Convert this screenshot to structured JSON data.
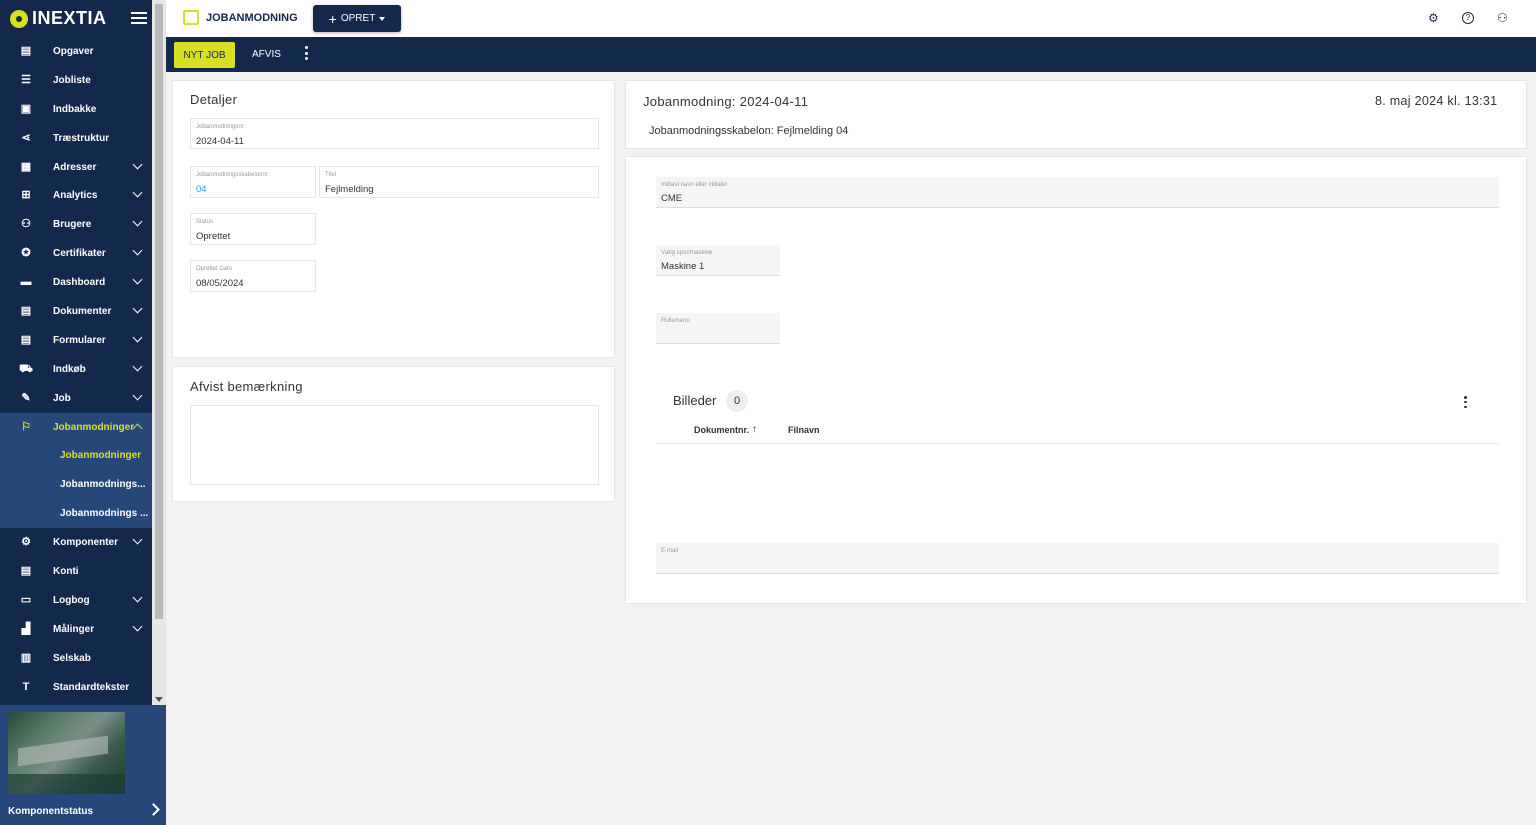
{
  "brand": "INEXTIA",
  "sidebar": {
    "items": [
      {
        "label": "Opgaver",
        "icon": "▤",
        "chev": false
      },
      {
        "label": "Jobliste",
        "icon": "☰",
        "chev": false
      },
      {
        "label": "Indbakke",
        "icon": "▣",
        "chev": false
      },
      {
        "label": "Træstruktur",
        "icon": "⋖",
        "chev": false
      },
      {
        "label": "Adresser",
        "icon": "▦",
        "chev": true
      },
      {
        "label": "Analytics",
        "icon": "⊞",
        "chev": true
      },
      {
        "label": "Brugere",
        "icon": "⚇",
        "chev": true
      },
      {
        "label": "Certifikater",
        "icon": "✪",
        "chev": true
      },
      {
        "label": "Dashboard",
        "icon": "▬",
        "chev": true
      },
      {
        "label": "Dokumenter",
        "icon": "▤",
        "chev": true
      },
      {
        "label": "Formularer",
        "icon": "▤",
        "chev": true
      },
      {
        "label": "Indkøb",
        "icon": "⛟",
        "chev": true
      },
      {
        "label": "Job",
        "icon": "✎",
        "chev": true
      },
      {
        "label": "Jobanmodninger",
        "icon": "⚐",
        "chev": true
      }
    ],
    "subitems": [
      "Jobanmodninger",
      "Jobanmodnings...",
      "Jobanmodnings ..."
    ],
    "items_after": [
      {
        "label": "Komponenter",
        "icon": "⚙",
        "chev": true
      },
      {
        "label": "Konti",
        "icon": "▤",
        "chev": false
      },
      {
        "label": "Logbog",
        "icon": "▭",
        "chev": true
      },
      {
        "label": "Målinger",
        "icon": "▟",
        "chev": true
      },
      {
        "label": "Selskab",
        "icon": "▥",
        "chev": false
      },
      {
        "label": "Standardtekster",
        "icon": "T",
        "chev": false
      }
    ],
    "widget_label": "Komponentstatus"
  },
  "topbar": {
    "title": "JOBANMODNING",
    "opret_label": "OPRET",
    "settings_icon": "⚙",
    "help_icon": "?",
    "user_icon": "⚇"
  },
  "actions": {
    "nyt_job": "NYT JOB",
    "afvis": "AFVIS"
  },
  "details": {
    "title": "Detaljer",
    "fields": [
      {
        "label": "Jobanmodningsnr.",
        "value": "2024-04-11"
      },
      {
        "label": "Jobanmodningsskabelonnr.",
        "value": "04"
      },
      {
        "label": "Titel",
        "value": "Fejlmelding"
      },
      {
        "label": "Status",
        "value": "Oprettet"
      },
      {
        "label": "Oprettet Dato",
        "value": "08/05/2024"
      }
    ]
  },
  "rejected": {
    "title": "Afvist bemærkning"
  },
  "header_card": {
    "title": "Jobanmodning: 2024-04-11",
    "date": "8. maj 2024 kl. 13:31",
    "template": "Jobanmodningsskabelon: Fejlmelding 04"
  },
  "form": {
    "name_label": "Indtast navn eller initialer",
    "name_value": "CME",
    "machine_label": "Vælg spor/maskine",
    "machine_value": "Maskine 1",
    "dropdown_label": "Rullemenu",
    "images_title": "Billeder",
    "images_count": "0",
    "col_doc": "Dokumentnr.",
    "col_file": "Filnavn",
    "email_label": "E-mail"
  }
}
